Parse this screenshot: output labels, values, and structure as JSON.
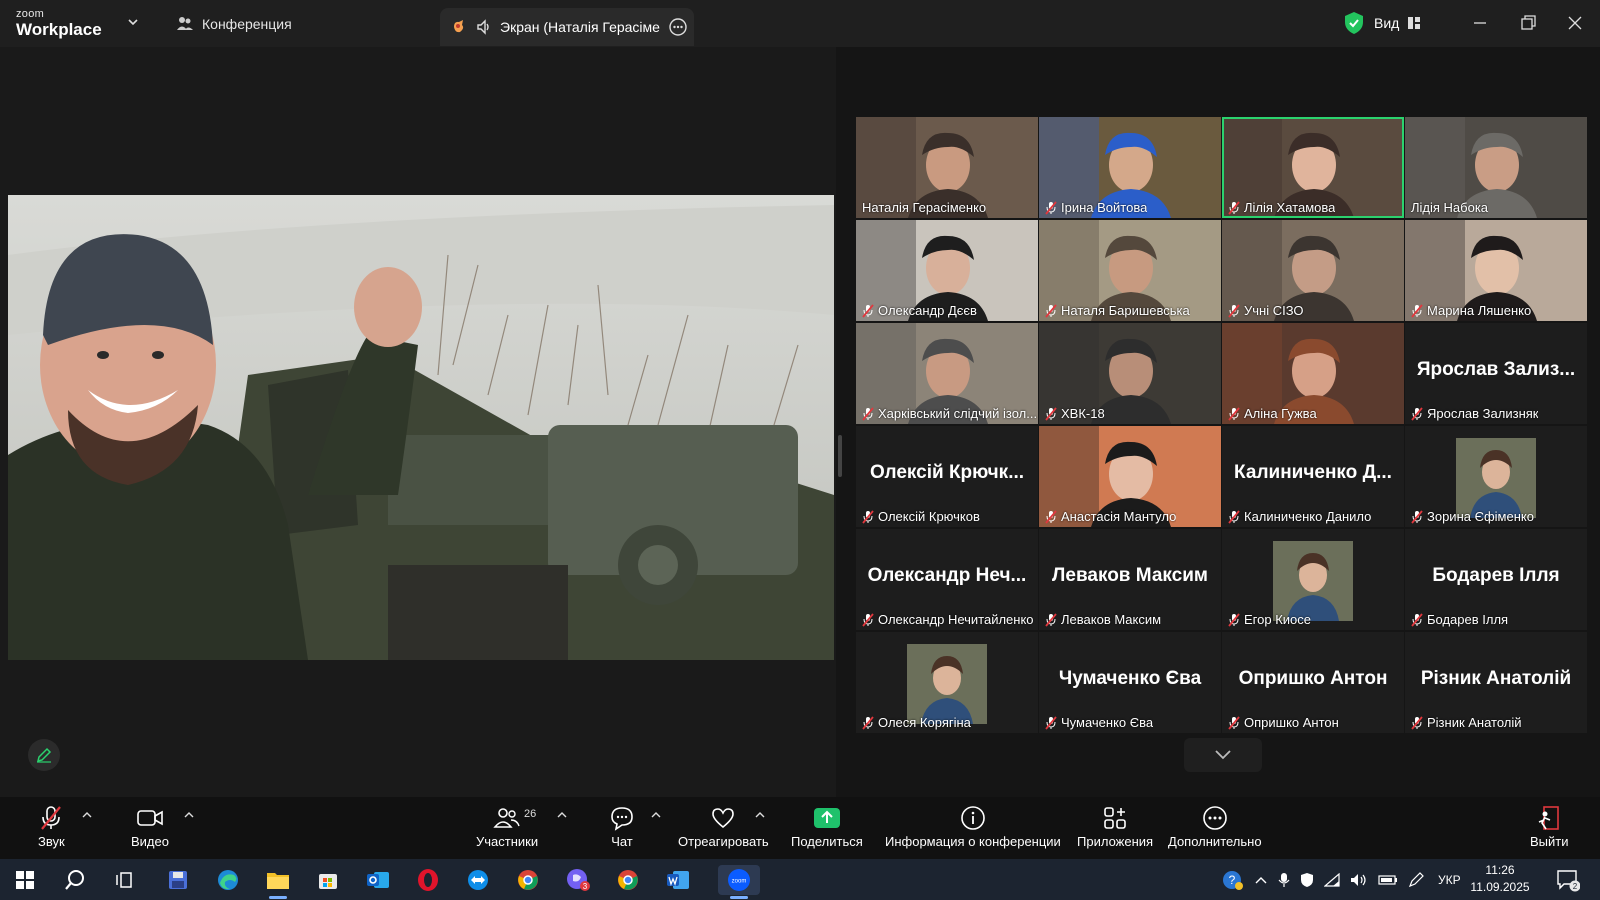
{
  "titlebar": {
    "brand_small": "zoom",
    "brand_large": "Workplace",
    "conference_tab": "Конференция",
    "screen_tab": "Экран (Наталія Герасіменк",
    "view_label": "Вид"
  },
  "gallery": {
    "tiles": [
      {
        "name": "Наталія Герасіменко",
        "muted": false,
        "type": "video",
        "active": false
      },
      {
        "name": "Ірина Войтова",
        "muted": true,
        "type": "video",
        "active": false
      },
      {
        "name": "Лілія Хатамова",
        "muted": true,
        "type": "video",
        "active": true
      },
      {
        "name": "Лідія Набока",
        "muted": false,
        "type": "video",
        "active": false
      },
      {
        "name": "Олександр Дєєв",
        "muted": true,
        "type": "video",
        "active": false
      },
      {
        "name": "Наталя Баришевська",
        "muted": true,
        "type": "video",
        "active": false
      },
      {
        "name": "Учні СІЗО",
        "muted": true,
        "type": "video",
        "active": false
      },
      {
        "name": "Марина Ляшенко",
        "muted": true,
        "type": "video",
        "active": false
      },
      {
        "name": "Харківський слідчий ізол...",
        "muted": true,
        "type": "video",
        "active": false
      },
      {
        "name": "ХВК-18",
        "muted": true,
        "type": "video",
        "active": false
      },
      {
        "name": "Аліна Гужва",
        "muted": true,
        "type": "video",
        "active": false
      },
      {
        "name": "Ярослав Зализняк",
        "display": "Ярослав Зализ...",
        "muted": true,
        "type": "name",
        "active": false
      },
      {
        "name": "Олексій Крючков",
        "display": "Олексій Крючк...",
        "muted": true,
        "type": "name",
        "active": false
      },
      {
        "name": "Анастасія Мантуло",
        "muted": true,
        "type": "video",
        "active": false
      },
      {
        "name": "Калиниченко Данило",
        "display": "Калиниченко Д...",
        "muted": true,
        "type": "name",
        "active": false
      },
      {
        "name": "Зорина  Єфіменко",
        "muted": true,
        "type": "photo",
        "active": false
      },
      {
        "name": "Олександр Нечитайленко",
        "display": "Олександр Неч...",
        "muted": true,
        "type": "name",
        "active": false
      },
      {
        "name": "Леваков Максим",
        "display": "Леваков Максим",
        "muted": true,
        "type": "name",
        "active": false
      },
      {
        "name": "Егор Киосе",
        "muted": true,
        "type": "photo",
        "active": false
      },
      {
        "name": "Бодарев Ілля",
        "display": "Бодарев Ілля",
        "muted": true,
        "type": "name",
        "active": false
      },
      {
        "name": "Олеся Корягіна",
        "muted": true,
        "type": "photo",
        "active": false
      },
      {
        "name": "Чумаченко Єва",
        "display": "Чумаченко Єва",
        "muted": true,
        "type": "name",
        "active": false
      },
      {
        "name": "Опришко Антон",
        "display": "Опришко Антон",
        "muted": true,
        "type": "name",
        "active": false
      },
      {
        "name": "Різник Анатолій",
        "display": "Різник Анатолій",
        "muted": true,
        "type": "name",
        "active": false
      }
    ]
  },
  "toolbar": {
    "audio": "Звук",
    "video": "Видео",
    "participants": "Участники",
    "participants_count": "26",
    "chat": "Чат",
    "react": "Отреагировать",
    "share": "Поделиться",
    "info": "Информация о конференции",
    "apps": "Приложения",
    "more": "Дополнительно",
    "leave": "Выйти"
  },
  "taskbar": {
    "language": "УКР",
    "time": "11:26",
    "date": "11.09.2025",
    "notifications": "2",
    "viber_badge": "3"
  },
  "colors": {
    "accent_green": "#2bd26e",
    "share_green": "#1fc16b",
    "mic_red": "#e0383e"
  }
}
